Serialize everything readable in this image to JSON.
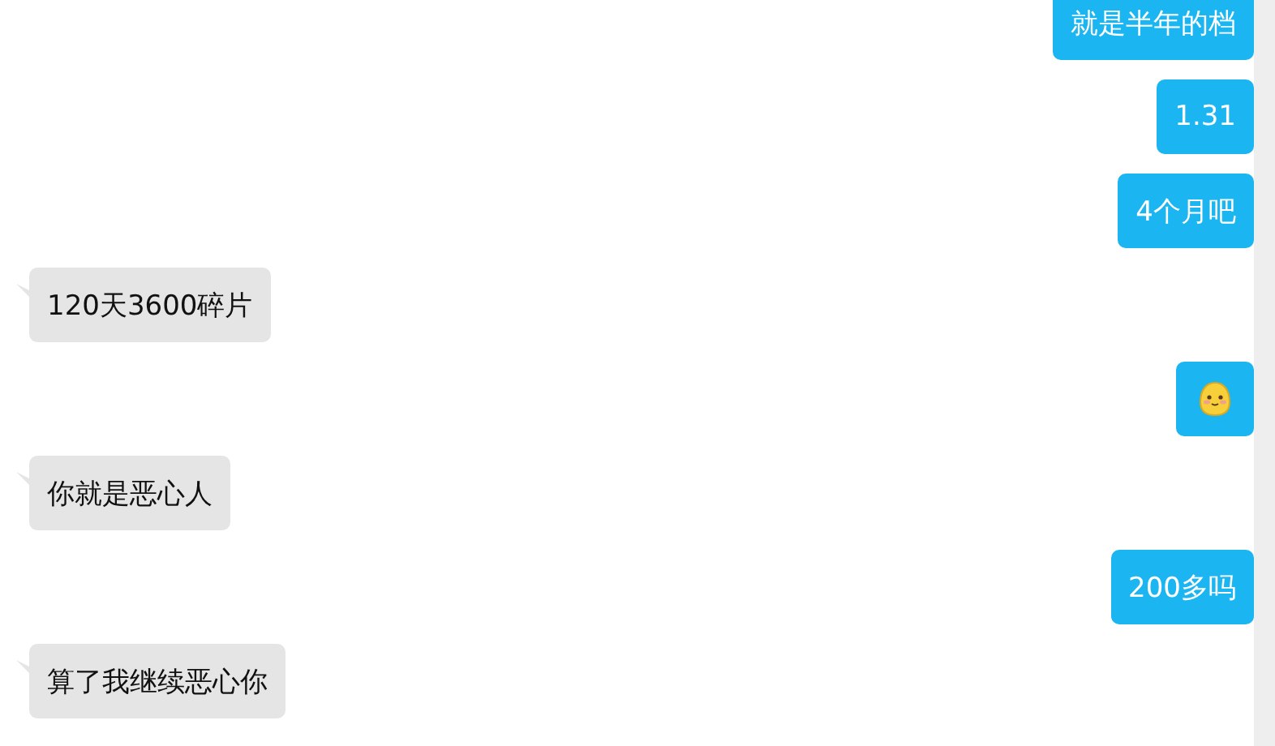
{
  "messages": [
    {
      "outgoing": true,
      "kind": "text",
      "text": "就是半年的档"
    },
    {
      "outgoing": true,
      "kind": "text",
      "text": "1.31"
    },
    {
      "outgoing": true,
      "kind": "text",
      "text": "4个月吧"
    },
    {
      "outgoing": false,
      "kind": "text",
      "text": "120天3600碎片"
    },
    {
      "outgoing": true,
      "kind": "emoji"
    },
    {
      "outgoing": false,
      "kind": "text",
      "text": "你就是恶心人"
    },
    {
      "outgoing": true,
      "kind": "text",
      "text": "200多吗"
    },
    {
      "outgoing": false,
      "kind": "text",
      "text": "算了我继续恶心你"
    }
  ]
}
